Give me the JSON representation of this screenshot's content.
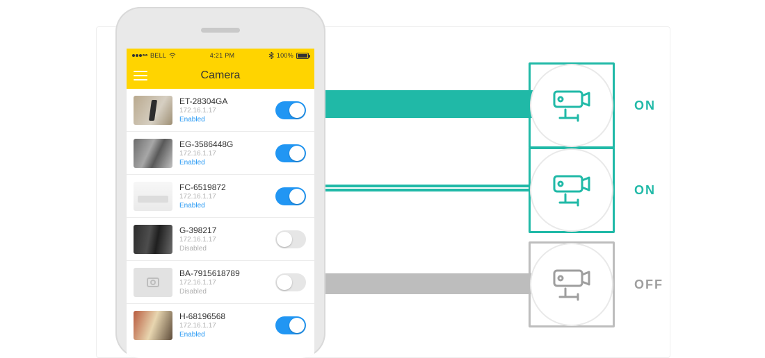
{
  "statusbar": {
    "carrier": "BELL",
    "time": "4:21 PM",
    "battery_pct": "100%"
  },
  "navbar": {
    "title": "Camera"
  },
  "list": {
    "items": [
      {
        "name": "ET-28304GA",
        "ip": "172.16.1.17",
        "state_label": "Enabled",
        "enabled": true
      },
      {
        "name": "EG-3586448G",
        "ip": "172.16.1.17",
        "state_label": "Enabled",
        "enabled": true
      },
      {
        "name": "FC-6519872",
        "ip": "172.16.1.17",
        "state_label": "Enabled",
        "enabled": true
      },
      {
        "name": "G-398217",
        "ip": "172.16.1.17",
        "state_label": "Disabled",
        "enabled": false
      },
      {
        "name": "BA-7915618789",
        "ip": "172.16.1.17",
        "state_label": "Disabled",
        "enabled": false
      },
      {
        "name": "H-68196568",
        "ip": "172.16.1.17",
        "state_label": "Enabled",
        "enabled": true
      }
    ]
  },
  "badges": [
    {
      "label": "ON",
      "color": "#20b9a7"
    },
    {
      "label": "ON",
      "color": "#20b9a7"
    },
    {
      "label": "OFF",
      "color": "#9e9e9e"
    }
  ],
  "colors": {
    "accent_yellow": "#ffd400",
    "toggle_on": "#2196f3",
    "teal": "#20b9a7",
    "grey": "#9e9e9e"
  }
}
